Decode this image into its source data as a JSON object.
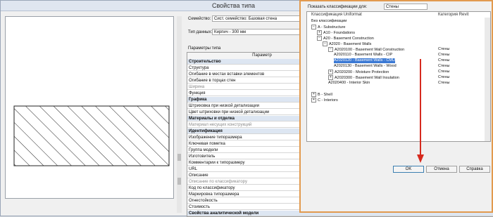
{
  "window": {
    "title": "Свойства типа"
  },
  "family": {
    "label": "Семейство:",
    "value": "Сист. семейство: Базовая стена"
  },
  "type": {
    "label": "Тип данных:",
    "value": "Кирпич - 300 мм"
  },
  "type_params_label": "Параметры типа",
  "grid": {
    "col_param": "Параметр",
    "rows": [
      {
        "k": "Строительство",
        "v": "",
        "kind": "grp"
      },
      {
        "k": "Структура",
        "v": ""
      },
      {
        "k": "Огибание в местах вставки элементов",
        "v": ""
      },
      {
        "k": "Огибание в торцах стен",
        "v": ""
      },
      {
        "k": "Ширина",
        "v": "",
        "kind": "dim"
      },
      {
        "k": "Функция",
        "v": ""
      },
      {
        "k": "Графика",
        "v": "",
        "kind": "grp"
      },
      {
        "k": "Штриховка при низкой детализации",
        "v": ""
      },
      {
        "k": "Цвет штриховки при низкой детализации",
        "v": ""
      },
      {
        "k": "Материалы и отделка",
        "v": "",
        "kind": "grp"
      },
      {
        "k": "Материал несущих конструкций",
        "v": "",
        "kind": "dim"
      },
      {
        "k": "Идентификация",
        "v": "",
        "kind": "grp"
      },
      {
        "k": "Изображение типоразмера",
        "v": ""
      },
      {
        "k": "Ключевая пометка",
        "v": ""
      },
      {
        "k": "Группа модели",
        "v": ""
      },
      {
        "k": "Изготовитель",
        "v": ""
      },
      {
        "k": "Комментарии к типоразмеру",
        "v": ""
      },
      {
        "k": "URL",
        "v": ""
      },
      {
        "k": "Описание",
        "v": ""
      },
      {
        "k": "Описание по классификатору",
        "v": "Basement Walls - CMU",
        "kind": "dim"
      },
      {
        "k": "Код по классификатору",
        "v": "A2020120"
      },
      {
        "k": "Маркировка типоразмера",
        "v": "К-01"
      },
      {
        "k": "Огнестойкость",
        "v": ""
      },
      {
        "k": "Стоимость",
        "v": ""
      },
      {
        "k": "Свойства аналитической модели",
        "v": "",
        "kind": "grp"
      }
    ]
  },
  "dialog": {
    "show_label": "Показать классификации для:",
    "show_value": "Стены",
    "col_class": "Классификация Uniformat",
    "col_cat": "Категория Revit",
    "nodes": [
      {
        "text": "Без классификации",
        "indent": 0,
        "tog": "",
        "cat": ""
      },
      {
        "text": "A - Substructure",
        "indent": 0,
        "tog": "−",
        "cat": ""
      },
      {
        "text": "A10 - Foundations",
        "indent": 1,
        "tog": "+",
        "cat": ""
      },
      {
        "text": "A20 - Basement Construction",
        "indent": 1,
        "tog": "−",
        "cat": ""
      },
      {
        "text": "A2020 - Basement Walls",
        "indent": 2,
        "tog": "−",
        "cat": ""
      },
      {
        "text": "A2020100 - Basement Wall Construction",
        "indent": 3,
        "tog": "−",
        "cat": "Стены"
      },
      {
        "text": "A2020110 - Basement Walls - CIP",
        "indent": 4,
        "tog": "",
        "cat": "Стены"
      },
      {
        "text": "A2020120 - Basement Walls - CMU",
        "indent": 4,
        "tog": "",
        "cat": "Стены",
        "sel": true
      },
      {
        "text": "A2020130 - Basement Walls - Wood",
        "indent": 4,
        "tog": "",
        "cat": "Стены"
      },
      {
        "text": "A2020200 - Moisture Protection",
        "indent": 3,
        "tog": "+",
        "cat": "Стены"
      },
      {
        "text": "A2020300 - Basement Wall Insulation",
        "indent": 3,
        "tog": "+",
        "cat": "Стены"
      },
      {
        "text": "A2020400 - Interior Skin",
        "indent": 3,
        "tog": "",
        "cat": "Стены"
      },
      {
        "text": "",
        "indent": 0,
        "tog": "",
        "cat": ""
      },
      {
        "text": "B - Shell",
        "indent": 0,
        "tog": "+",
        "cat": ""
      },
      {
        "text": "C - Interiors",
        "indent": 0,
        "tog": "+",
        "cat": ""
      }
    ],
    "ok": "OK",
    "cancel": "Отмена",
    "help": "Справка"
  },
  "colors": {
    "accent_border": "#e29a4e",
    "selection": "#3b79d4",
    "arrow": "#d62a1e"
  }
}
